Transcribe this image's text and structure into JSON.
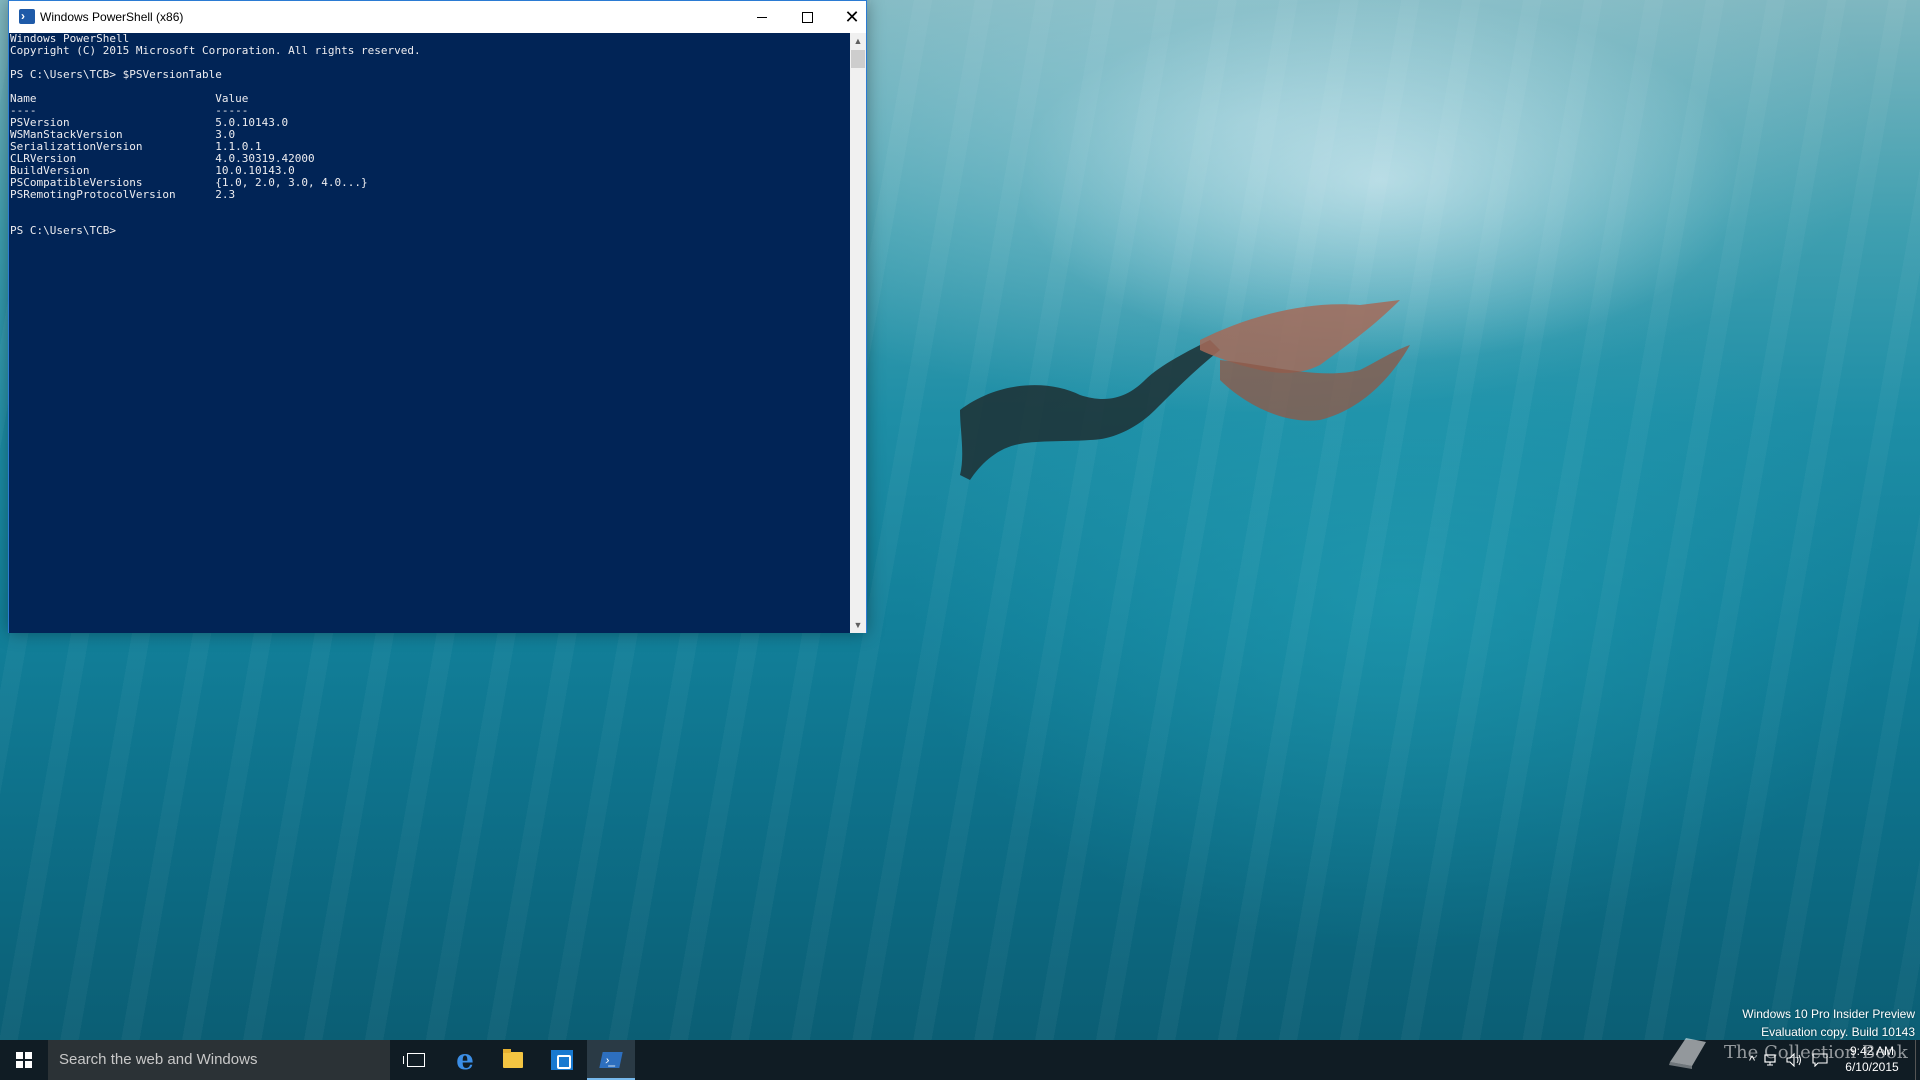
{
  "window": {
    "title": "Windows PowerShell (x86)",
    "icon": "powershell-icon",
    "controls": [
      "minimize-icon",
      "maximize-icon",
      "close-icon"
    ],
    "background_color": "#012456",
    "text_color": "#eeedf0"
  },
  "console": {
    "lines": [
      "Windows PowerShell",
      "Copyright (C) 2015 Microsoft Corporation. All rights reserved.",
      "",
      "PS C:\\Users\\TCB> $PSVersionTable",
      "",
      "Name                           Value",
      "----                           -----",
      "PSVersion                      5.0.10143.0",
      "WSManStackVersion              3.0",
      "SerializationVersion           1.1.0.1",
      "CLRVersion                     4.0.30319.42000",
      "BuildVersion                   10.0.10143.0",
      "PSCompatibleVersions           {1.0, 2.0, 3.0, 4.0...}",
      "PSRemotingProtocolVersion      2.3",
      "",
      "",
      "PS C:\\Users\\TCB>"
    ]
  },
  "watermark": {
    "line1": "Windows 10 Pro Insider Preview",
    "line2": "Evaluation copy. Build 10143"
  },
  "taskbar": {
    "search_placeholder": "Search the web and Windows",
    "pinned": [
      "task-view-icon",
      "edge-icon",
      "file-explorer-icon",
      "store-icon",
      "powershell-icon"
    ],
    "clock_time": "9:42 AM",
    "clock_date": "6/10/2015",
    "tray_icons": [
      "chevron-up-icon",
      "network-icon",
      "volume-icon",
      "action-center-icon"
    ]
  },
  "overlay_logo": {
    "text": "The Collection Book"
  }
}
